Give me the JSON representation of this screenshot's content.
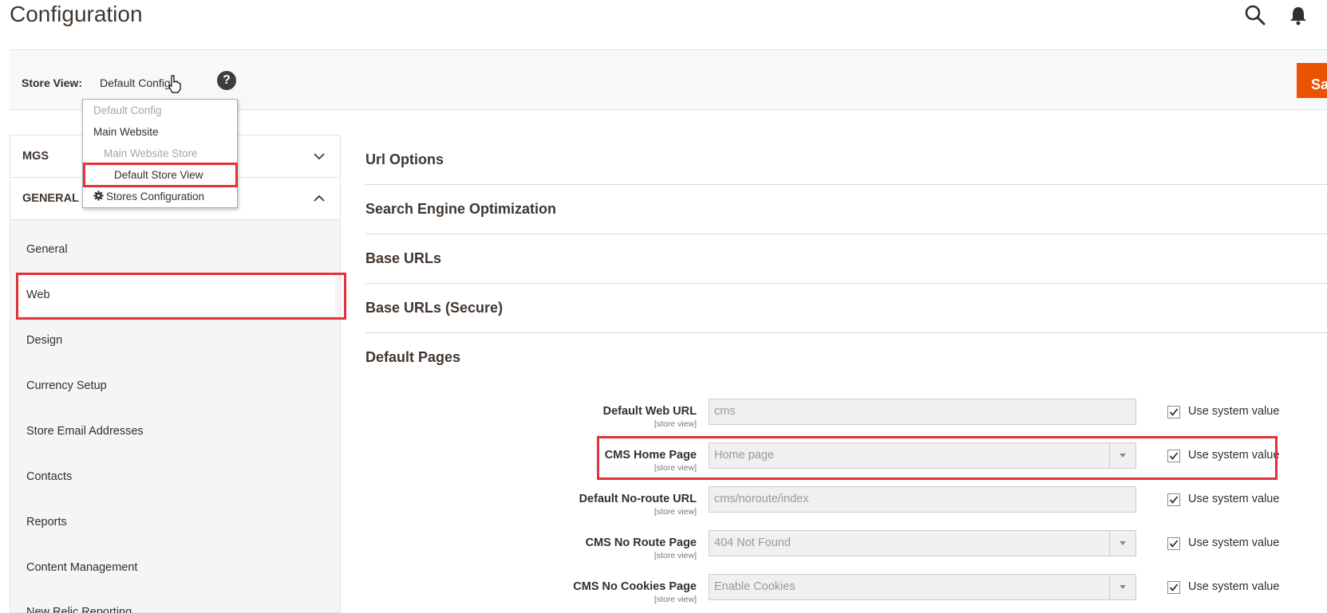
{
  "header": {
    "title": "Configuration",
    "icons": [
      "search-icon",
      "bell-icon"
    ]
  },
  "store_bar": {
    "label": "Store View:",
    "selected": "Default Config",
    "help": "?",
    "save_label": "Save"
  },
  "dropdown": {
    "items": [
      "Default Config",
      "Main Website",
      "Main Website Store",
      "Default Store View",
      "Stores Configuration"
    ]
  },
  "sidebar": {
    "groups": [
      "MGS",
      "GENERAL"
    ],
    "items": [
      "General",
      "Web",
      "Design",
      "Currency Setup",
      "Store Email Addresses",
      "Contacts",
      "Reports",
      "Content Management",
      "New Relic Reporting"
    ]
  },
  "sections": [
    "Url Options",
    "Search Engine Optimization",
    "Base URLs",
    "Base URLs (Secure)",
    "Default Pages"
  ],
  "fields": [
    {
      "label": "Default Web URL",
      "scope": "[store view]",
      "value": "cms",
      "type": "text",
      "use_system": "Use system value"
    },
    {
      "label": "CMS Home Page",
      "scope": "[store view]",
      "value": "Home page",
      "type": "select",
      "use_system": "Use system value"
    },
    {
      "label": "Default No-route URL",
      "scope": "[store view]",
      "value": "cms/noroute/index",
      "type": "text",
      "use_system": "Use system value"
    },
    {
      "label": "CMS No Route Page",
      "scope": "[store view]",
      "value": "404 Not Found",
      "type": "select",
      "use_system": "Use system value"
    },
    {
      "label": "CMS No Cookies Page",
      "scope": "[store view]",
      "value": "Enable Cookies",
      "type": "select",
      "use_system": "Use system value"
    }
  ],
  "colors": {
    "accent": "#eb5202",
    "highlight": "#e2323a",
    "sidebar_bg": "#f5f5f5"
  }
}
